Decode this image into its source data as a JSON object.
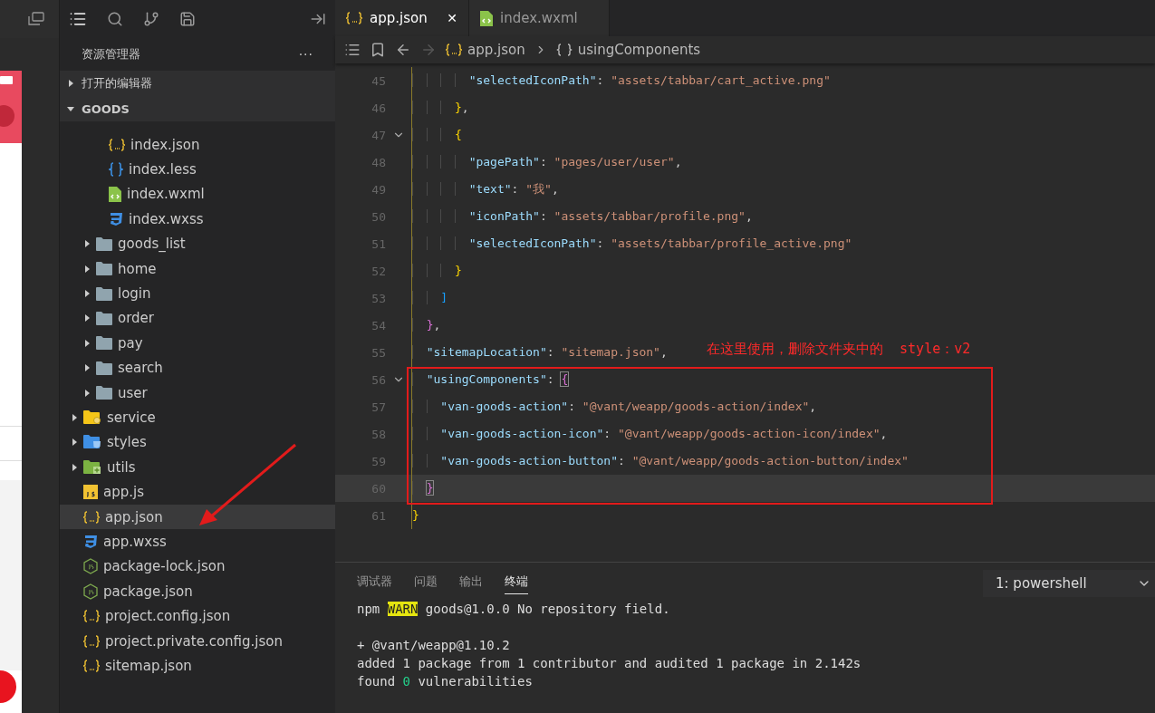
{
  "explorer": {
    "title": "资源管理器",
    "more": "···",
    "sections": [
      {
        "label": "打开的编辑器",
        "expanded": false
      },
      {
        "label": "GOODS",
        "expanded": true
      }
    ],
    "tree": [
      {
        "children": [
          {
            "children": [
              {
                "label": "index.json",
                "kind": "json",
                "selected": false
              },
              {
                "label": "index.less",
                "kind": "less",
                "selected": false
              },
              {
                "label": "index.wxml",
                "kind": "wxml",
                "selected": false
              },
              {
                "label": "index.wxss",
                "kind": "wxss",
                "selected": false
              }
            ]
          },
          {
            "label": "goods_list",
            "kind": "folder",
            "expanded": false,
            "selected": false
          },
          {
            "label": "home",
            "kind": "folder",
            "expanded": false,
            "selected": false
          },
          {
            "label": "login",
            "kind": "folder",
            "expanded": false,
            "selected": false
          },
          {
            "label": "order",
            "kind": "folder",
            "expanded": false,
            "selected": false
          },
          {
            "label": "pay",
            "kind": "folder",
            "expanded": false,
            "selected": false
          },
          {
            "label": "search",
            "kind": "folder",
            "expanded": false,
            "selected": false
          },
          {
            "label": "user",
            "kind": "folder",
            "expanded": false,
            "selected": false
          }
        ]
      },
      {
        "label": "service",
        "kind": "gearfolder",
        "expanded": false,
        "selected": false
      },
      {
        "label": "styles",
        "kind": "cssfolder",
        "expanded": false,
        "selected": false
      },
      {
        "label": "utils",
        "kind": "plusfolder",
        "expanded": false,
        "selected": false
      },
      {
        "label": "app.js",
        "kind": "js",
        "selected": false
      },
      {
        "label": "app.json",
        "kind": "json",
        "selected": true
      },
      {
        "label": "app.wxss",
        "kind": "wxss",
        "selected": false
      },
      {
        "label": "package-lock.json",
        "kind": "node",
        "selected": false
      },
      {
        "label": "package.json",
        "kind": "node",
        "selected": false
      },
      {
        "label": "project.config.json",
        "kind": "json",
        "selected": false
      },
      {
        "label": "project.private.config.json",
        "kind": "json",
        "selected": false
      },
      {
        "label": "sitemap.json",
        "kind": "json",
        "selected": false
      }
    ]
  },
  "tabs": [
    {
      "label": "app.json",
      "kind": "json",
      "selected": true,
      "close": "✕"
    },
    {
      "label": "index.wxml",
      "kind": "wxml",
      "selected": false
    }
  ],
  "breadcrumb": [
    {
      "label": "app.json",
      "kind": "json"
    },
    {
      "label": "usingComponents",
      "kind": "braces"
    }
  ],
  "code": [
    {
      "number": "45",
      "segments": [
        {
          "kind": "key",
          "text": "        \"selectedIconPath\""
        },
        {
          "kind": "punct",
          "text": ": "
        },
        {
          "kind": "string",
          "text": "\"assets/tabbar/cart_active.png\""
        }
      ]
    },
    {
      "number": "46",
      "segments": [
        {
          "kind": "bracket1",
          "text": "      }"
        },
        {
          "kind": "punct",
          "text": ","
        }
      ]
    },
    {
      "number": "47",
      "fold": true,
      "segments": [
        {
          "kind": "bracket1",
          "text": "      {"
        }
      ]
    },
    {
      "number": "48",
      "segments": [
        {
          "kind": "key",
          "text": "        \"pagePath\""
        },
        {
          "kind": "punct",
          "text": ": "
        },
        {
          "kind": "string",
          "text": "\"pages/user/user\""
        },
        {
          "kind": "punct",
          "text": ","
        }
      ]
    },
    {
      "number": "49",
      "segments": [
        {
          "kind": "key",
          "text": "        \"text\""
        },
        {
          "kind": "punct",
          "text": ": "
        },
        {
          "kind": "string",
          "text": "\"我\""
        },
        {
          "kind": "punct",
          "text": ","
        }
      ]
    },
    {
      "number": "50",
      "segments": [
        {
          "kind": "key",
          "text": "        \"iconPath\""
        },
        {
          "kind": "punct",
          "text": ": "
        },
        {
          "kind": "string",
          "text": "\"assets/tabbar/profile.png\""
        },
        {
          "kind": "punct",
          "text": ","
        }
      ]
    },
    {
      "number": "51",
      "segments": [
        {
          "kind": "key",
          "text": "        \"selectedIconPath\""
        },
        {
          "kind": "punct",
          "text": ": "
        },
        {
          "kind": "string",
          "text": "\"assets/tabbar/profile_active.png\""
        }
      ]
    },
    {
      "number": "52",
      "segments": [
        {
          "kind": "bracket1",
          "text": "      }"
        }
      ]
    },
    {
      "number": "53",
      "segments": [
        {
          "kind": "bracket3",
          "text": "    ]"
        }
      ]
    },
    {
      "number": "54",
      "segments": [
        {
          "kind": "bracket2",
          "text": "  }"
        },
        {
          "kind": "punct",
          "text": ","
        }
      ]
    },
    {
      "number": "55",
      "segments": [
        {
          "kind": "key",
          "text": "  \"sitemapLocation\""
        },
        {
          "kind": "punct",
          "text": ": "
        },
        {
          "kind": "string",
          "text": "\"sitemap.json\""
        },
        {
          "kind": "punct",
          "text": ","
        }
      ]
    },
    {
      "number": "56",
      "fold": true,
      "segments": [
        {
          "kind": "key",
          "text": "  \"usingComponents\""
        },
        {
          "kind": "punct",
          "text": ": "
        },
        {
          "kind": "match",
          "text": "{"
        }
      ]
    },
    {
      "number": "57",
      "segments": [
        {
          "kind": "key",
          "text": "    \"van-goods-action\""
        },
        {
          "kind": "punct",
          "text": ": "
        },
        {
          "kind": "string",
          "text": "\"@vant/weapp/goods-action/index\""
        },
        {
          "kind": "punct",
          "text": ","
        }
      ]
    },
    {
      "number": "58",
      "segments": [
        {
          "kind": "key",
          "text": "    \"van-goods-action-icon\""
        },
        {
          "kind": "punct",
          "text": ": "
        },
        {
          "kind": "string",
          "text": "\"@vant/weapp/goods-action-icon/index\""
        },
        {
          "kind": "punct",
          "text": ","
        }
      ]
    },
    {
      "number": "59",
      "segments": [
        {
          "kind": "key",
          "text": "    \"van-goods-action-button\""
        },
        {
          "kind": "punct",
          "text": ": "
        },
        {
          "kind": "string",
          "text": "\"@vant/weapp/goods-action-button/index\""
        }
      ]
    },
    {
      "number": "60",
      "current": true,
      "segments": [
        {
          "kind": "match",
          "text": "  }"
        }
      ]
    },
    {
      "number": "61",
      "segments": [
        {
          "kind": "bracket1",
          "text": "}"
        }
      ]
    }
  ],
  "annotation": {
    "text": "在这里使用，删除文件夹中的  style：v2"
  },
  "panel": {
    "tabs": [
      {
        "label": "调试器",
        "selected": false
      },
      {
        "label": "问题",
        "selected": false
      },
      {
        "label": "输出",
        "selected": false
      },
      {
        "label": "终端",
        "selected": true
      }
    ],
    "terminal_select": "1: powershell",
    "blocks": [
      [
        {
          "segments": [
            {
              "kind": "text",
              "text": "npm "
            },
            {
              "kind": "warn",
              "text": "WARN"
            },
            {
              "kind": "text",
              "text": " goods@1.0.0 No repository field."
            }
          ]
        }
      ],
      [
        {
          "segments": [
            {
              "kind": "text",
              "text": "+ @vant/weapp@1.10.2"
            }
          ]
        },
        {
          "segments": [
            {
              "kind": "text",
              "text": "added 1 package from 1 contributor and audited 1 package in 2.142s"
            }
          ]
        },
        {
          "segments": [
            {
              "kind": "text",
              "text": "found "
            },
            {
              "kind": "ok",
              "text": "0"
            },
            {
              "kind": "text",
              "text": " vulnerabilities"
            }
          ]
        }
      ]
    ]
  }
}
